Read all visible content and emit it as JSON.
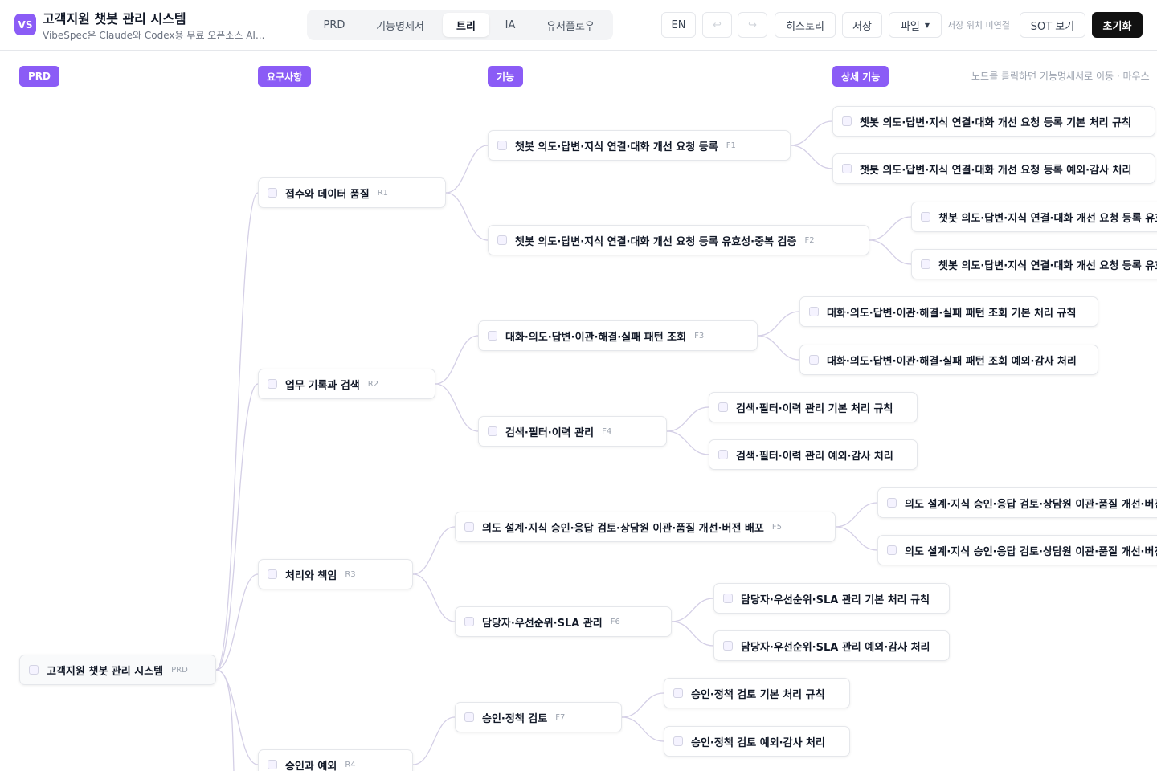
{
  "app": {
    "logo": "VS",
    "title": "고객지원 챗봇 관리 시스템",
    "subtitle": "VibeSpec은 Claude와 Codex용 무료 오픈소스 AI..."
  },
  "tabs": [
    "PRD",
    "기능명세서",
    "트리",
    "IA",
    "유저플로우"
  ],
  "active_tab": "트리",
  "toolbar": {
    "lang": "EN",
    "undo_icon": "undo-icon",
    "redo_icon": "redo-icon",
    "history": "히스토리",
    "save": "저장",
    "file": "파일",
    "save_status": "저장 위치 미연결",
    "sot_view": "SOT 보기",
    "reset": "초기화"
  },
  "columns": [
    "PRD",
    "요구사항",
    "기능",
    "상세 기능"
  ],
  "hint": "노드를 클릭하면 기능명세서로 이동 · 마우스",
  "tree": {
    "root": {
      "label": "고객지원 챗봇 관리 시스템",
      "code": "PRD"
    },
    "requirements": [
      {
        "label": "접수와 데이터 품질",
        "code": "R1"
      },
      {
        "label": "업무 기록과 검색",
        "code": "R2"
      },
      {
        "label": "처리와 책임",
        "code": "R3"
      },
      {
        "label": "승인과 예외",
        "code": "R4"
      }
    ],
    "features": [
      {
        "label": "챗봇 의도·답변·지식 연결·대화 개선 요청 등록",
        "code": "F1"
      },
      {
        "label": "챗봇 의도·답변·지식 연결·대화 개선 요청 등록 유효성·중복 검증",
        "code": "F2"
      },
      {
        "label": "대화·의도·답변·이관·해결·실패 패턴 조회",
        "code": "F3"
      },
      {
        "label": "검색·필터·이력 관리",
        "code": "F4"
      },
      {
        "label": "의도 설계·지식 승인·응답 검토·상담원 이관·품질 개선·버전 배포",
        "code": "F5"
      },
      {
        "label": "담당자·우선순위·SLA 관리",
        "code": "F6"
      },
      {
        "label": "승인·정책 검토",
        "code": "F7"
      }
    ],
    "details": [
      "챗봇 의도·답변·지식 연결·대화 개선 요청 등록 기본 처리 규칙",
      "챗봇 의도·답변·지식 연결·대화 개선 요청 등록 예외·감사 처리",
      "챗봇 의도·답변·지식 연결·대화 개선 요청 등록 유효성·중복 검증 기본 처리 규칙",
      "챗봇 의도·답변·지식 연결·대화 개선 요청 등록 유효성·중복 검증 예외·감사 처리",
      "대화·의도·답변·이관·해결·실패 패턴 조회 기본 처리 규칙",
      "대화·의도·답변·이관·해결·실패 패턴 조회 예외·감사 처리",
      "검색·필터·이력 관리 기본 처리 규칙",
      "검색·필터·이력 관리 예외·감사 처리",
      "의도 설계·지식 승인·응답 검토·상담원 이관·품질 개선·버전 배포 기본 처리 규칙",
      "의도 설계·지식 승인·응답 검토·상담원 이관·품질 개선·버전 배포 예외·감사 처리",
      "담당자·우선순위·SLA 관리 기본 처리 규칙",
      "담당자·우선순위·SLA 관리 예외·감사 처리",
      "승인·정책 검토 기본 처리 규칙",
      "승인·정책 검토 예외·감사 처리"
    ]
  }
}
